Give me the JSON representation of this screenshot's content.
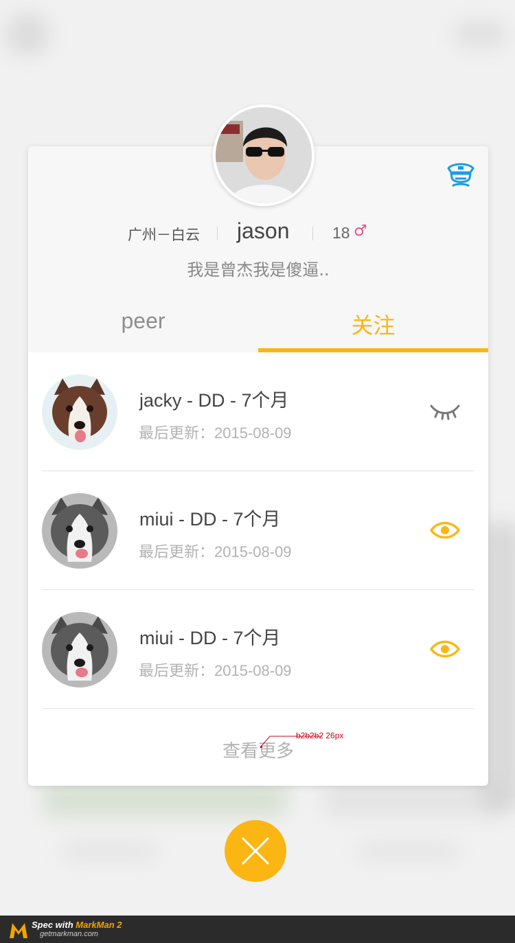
{
  "profile": {
    "location": "广州－白云",
    "username": "jason",
    "age": "18",
    "gender_symbol": "♂",
    "bio": "我是曾杰我是傻逼.."
  },
  "tabs": [
    {
      "label": "peer",
      "active": false
    },
    {
      "label": "关注",
      "active": true
    }
  ],
  "pets": [
    {
      "name": "jacky - DD - 7个月",
      "updated": "最后更新：2015-08-09",
      "icon": "eye-closed-icon"
    },
    {
      "name": "miui - DD - 7个月",
      "updated": "最后更新：2015-08-09",
      "icon": "eye-open-icon"
    },
    {
      "name": "miui - DD - 7个月",
      "updated": "最后更新：2015-08-09",
      "icon": "eye-open-icon"
    }
  ],
  "more_label": "查看更多",
  "annotation": "b2b2b2  26px",
  "footer": {
    "spec_with": "Spec with ",
    "brand": "MarkMan 2",
    "site": "getmarkman.com"
  },
  "colors": {
    "accent": "#fbb614",
    "police_icon": "#1a9be6",
    "muted_text": "#b2b2b2",
    "gender": "#e8508a"
  }
}
